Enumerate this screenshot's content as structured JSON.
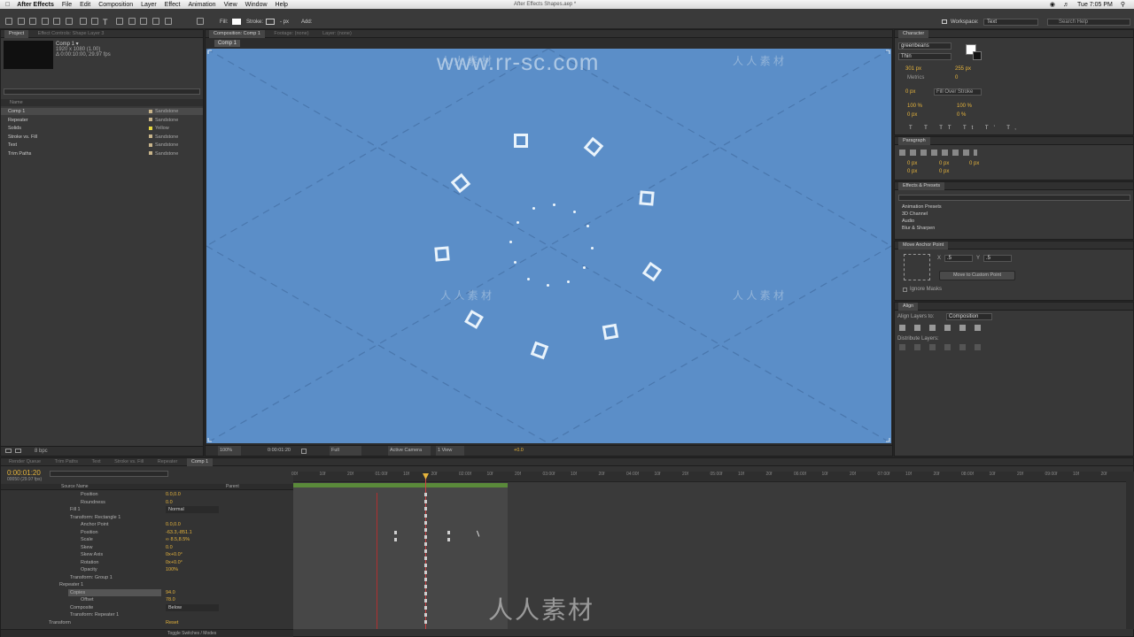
{
  "menubar": {
    "app": "After Effects",
    "items": [
      "File",
      "Edit",
      "Composition",
      "Layer",
      "Effect",
      "Animation",
      "View",
      "Window",
      "Help"
    ],
    "title": "After Effects Shapes.aep *",
    "clock": "Tue 7:05 PM"
  },
  "toolbar": {
    "fill_label": "Fill:",
    "stroke_label": "Stroke:",
    "stroke_px": "- px",
    "add_label": "Add:",
    "workspace_label": "Workspace:",
    "workspace_value": "Text",
    "search_placeholder": "Search Help"
  },
  "watermark": {
    "url": "www.rr-sc.com",
    "cn": "人 人 素 材",
    "bottom_cn": "人人素材"
  },
  "project": {
    "tab": "Project",
    "tab2": "Effect Controls: Shape Layer 3",
    "comp_name": "Comp 1 ▾",
    "comp_res": "1920 x 1080 (1.00)",
    "comp_dur": "Δ 0:00:10:00, 29.97 fps",
    "col_name": "Name",
    "items": [
      {
        "name": "Comp 1",
        "label": "Sandstone",
        "color": "#c8b48a"
      },
      {
        "name": "Repeater",
        "label": "Sandstone",
        "color": "#c8b48a"
      },
      {
        "name": "Solids",
        "label": "Yellow",
        "color": "#e8d840"
      },
      {
        "name": "Stroke vs. Fill",
        "label": "Sandstone",
        "color": "#c8b48a"
      },
      {
        "name": "Text",
        "label": "Sandstone",
        "color": "#c8b48a"
      },
      {
        "name": "Trim Paths",
        "label": "Sandstone",
        "color": "#c8b48a"
      }
    ],
    "bpc": "8 bpc"
  },
  "viewer": {
    "tab": "Composition: Comp 1",
    "footage": "Footage: (none)",
    "layer": "Layer: (none)",
    "comp_chip": "Comp 1",
    "zoom": "100%",
    "timecode": "0:00:01:20",
    "quality": "Full",
    "camera": "Active Camera",
    "views": "1 View",
    "exposure": "+0.0",
    "bg": "#5b8ec8"
  },
  "character": {
    "tab": "Character",
    "font": "greenbeans",
    "style": "Thin",
    "size": "301 px",
    "leading": "255 px",
    "kerning": "Metrics",
    "tracking": "0",
    "stroke_w": "0 px",
    "stroke_mode": "Fill Over Stroke",
    "vscale": "100 %",
    "hscale": "100 %",
    "baseline": "0 px",
    "tsume": "0 %"
  },
  "paragraph": {
    "tab": "Paragraph",
    "v1": "0 px",
    "v2": "0 px",
    "v3": "0 px",
    "v4": "0 px",
    "v5": "0 px"
  },
  "effects": {
    "tab": "Effects & Presets",
    "items": [
      "Animation Presets",
      "3D Channel",
      "Audio",
      "Blur & Sharpen"
    ]
  },
  "anchor": {
    "tab": "Move Anchor Point",
    "x_label": "X",
    "x": ".5",
    "y_label": "Y",
    "y": ".5",
    "button": "Move to Custom Point",
    "ignore": "Ignore Masks"
  },
  "align": {
    "tab": "Align",
    "layers_to": "Align Layers to:",
    "target": "Composition",
    "distribute": "Distribute Layers:"
  },
  "timeline": {
    "tabs": [
      "Render Queue",
      "Trim Paths",
      "Text",
      "Stroke vs. Fill",
      "Repeater",
      "Comp 1"
    ],
    "timecode": "0:00:01:20",
    "frames": "00050 (29.97 fps)",
    "col_source": "Source Name",
    "col_parent": "Parent",
    "footer": "Toggle Switches / Modes",
    "ruler": [
      "00f",
      "10f",
      "20f",
      "01:00f",
      "10f",
      "20f",
      "02:00f",
      "10f",
      "20f",
      "03:00f",
      "10f",
      "20f",
      "04:00f",
      "10f",
      "20f",
      "05:00f",
      "10f",
      "20f",
      "06:00f",
      "10f",
      "20f",
      "07:00f",
      "10f",
      "20f",
      "08:00f",
      "10f",
      "20f",
      "09:00f",
      "10f",
      "20f",
      "10:0"
    ],
    "props": [
      {
        "name": "Position",
        "value": "0.0,0.0",
        "indent": 1
      },
      {
        "name": "Roundness",
        "value": "0.0",
        "indent": 1
      },
      {
        "name": "Fill 1",
        "value": "Normal",
        "indent": 0
      },
      {
        "name": "Transform: Rectangle 1",
        "value": "",
        "indent": 0
      },
      {
        "name": "Anchor Point",
        "value": "0.0,0.0",
        "indent": 1
      },
      {
        "name": "Position",
        "value": "-63.3,-851.1",
        "indent": 1
      },
      {
        "name": "Scale",
        "value": "∞ 8.5,8.5%",
        "indent": 1
      },
      {
        "name": "Skew",
        "value": "0.0",
        "indent": 1
      },
      {
        "name": "Skew Axis",
        "value": "0x+0.0°",
        "indent": 1
      },
      {
        "name": "Rotation",
        "value": "0x+0.0°",
        "indent": 1
      },
      {
        "name": "Opacity",
        "value": "100%",
        "indent": 1
      },
      {
        "name": "Transform: Group 1",
        "value": "",
        "indent": 0
      },
      {
        "name": "Repeater 1",
        "value": "",
        "indent": -1
      },
      {
        "name": "Copies",
        "value": "94.0",
        "indent": 1
      },
      {
        "name": "Offset",
        "value": "78.0",
        "indent": 1
      },
      {
        "name": "Composite",
        "value": "Below",
        "indent": 0
      },
      {
        "name": "Transform: Repeater 1",
        "value": "",
        "indent": 0
      },
      {
        "name": "Transform",
        "value": "Reset",
        "indent": -2
      }
    ]
  }
}
